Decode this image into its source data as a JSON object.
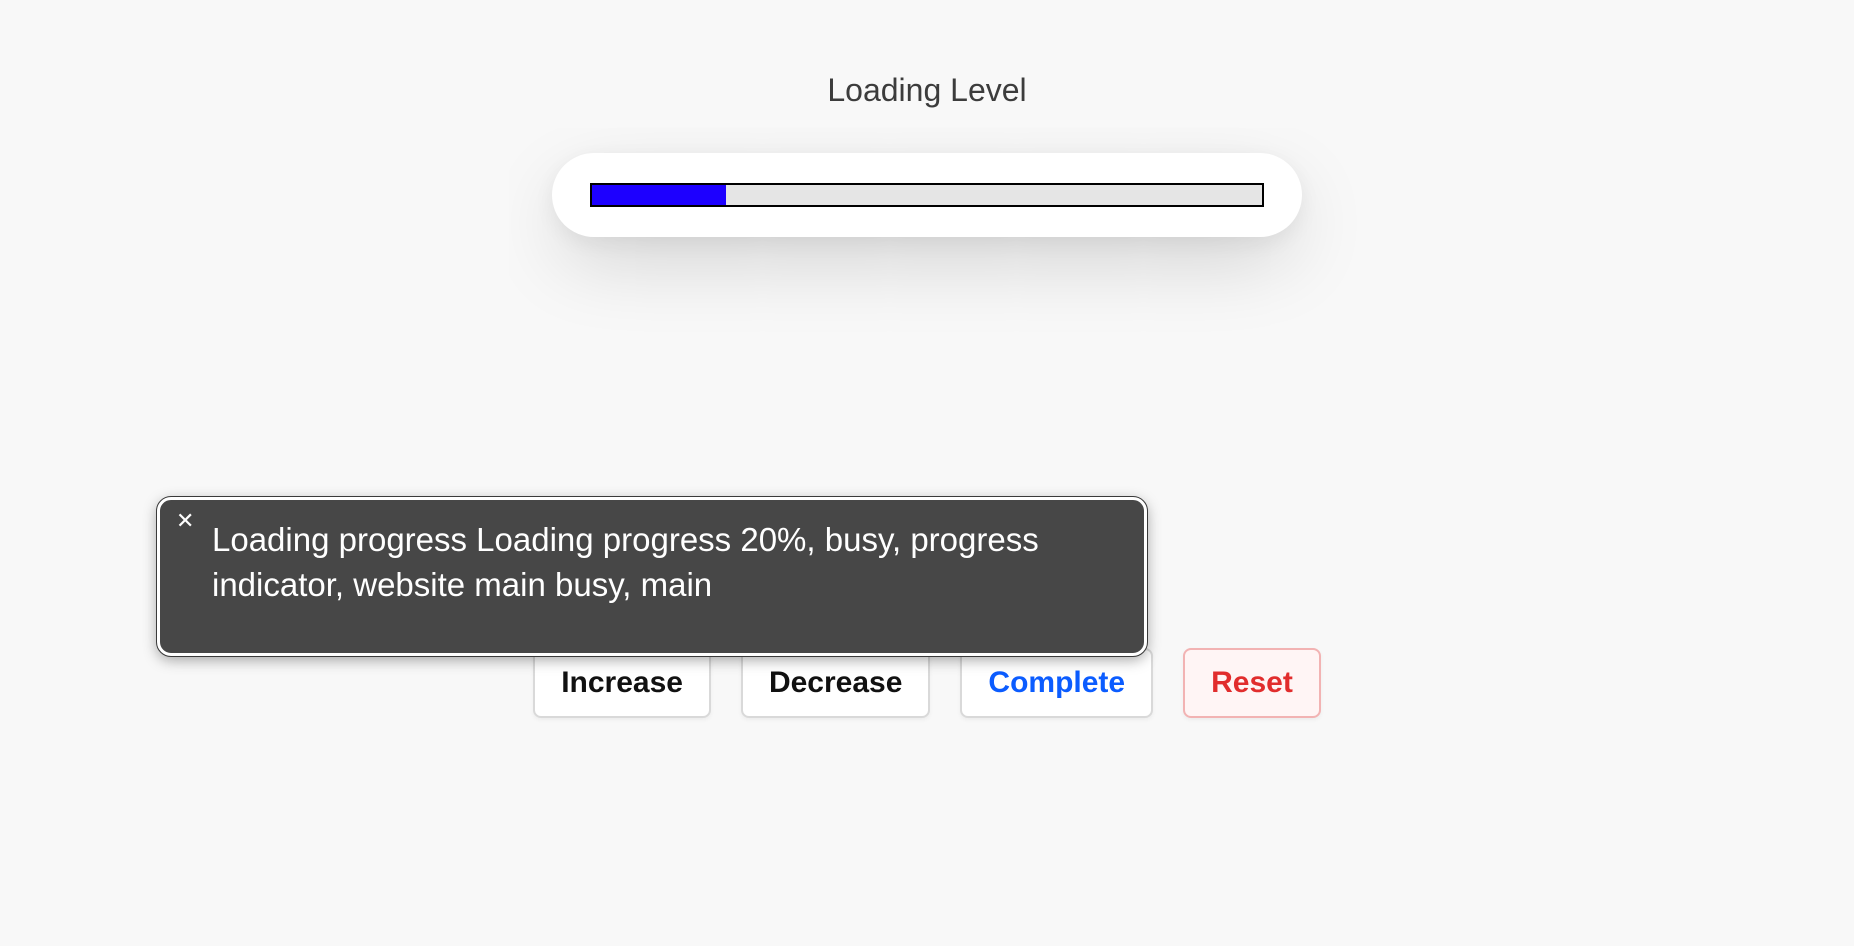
{
  "title": "Loading Level",
  "progress": {
    "percent": 20
  },
  "buttons": {
    "increase": "Increase",
    "decrease": "Decrease",
    "complete": "Complete",
    "reset": "Reset"
  },
  "tooltip": {
    "close_glyph": "✕",
    "text": "Loading progress Loading progress 20%, busy, progress indicator, website main busy, main"
  }
}
